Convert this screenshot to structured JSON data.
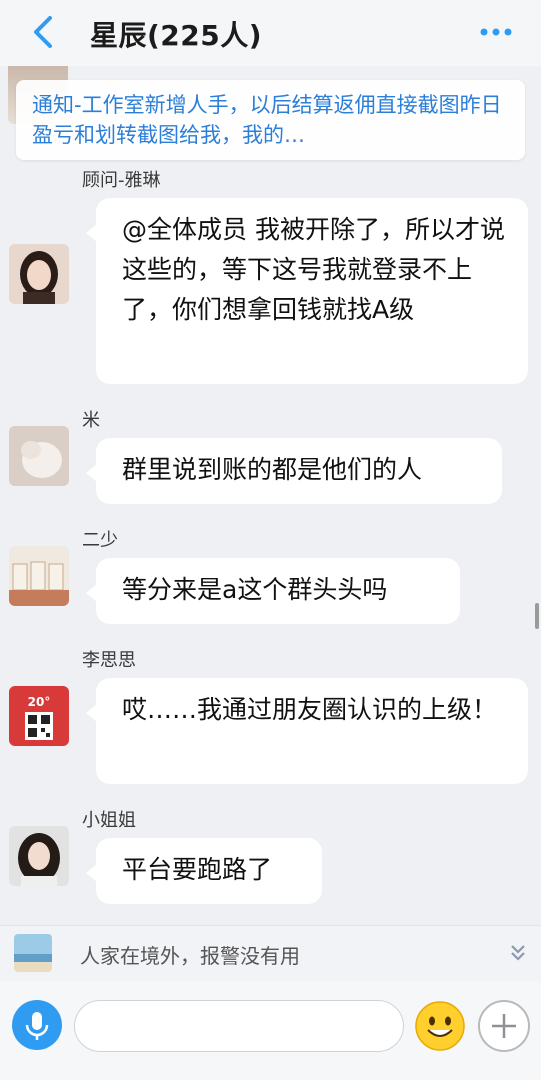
{
  "header": {
    "title": "星辰(225人)",
    "back_icon": "chevron-left-icon",
    "more_icon": "more-dots-icon",
    "accent_color": "#2f9cf2"
  },
  "notice": {
    "text": "通知-工作室新增人手，以后结算返佣直接截图昨日盈亏和划转截图给我，我的…",
    "color": "#2b7fd9"
  },
  "messages": [
    {
      "sender": "顾问-雅琳",
      "text": "@全体成员 我被开除了，所以才说这些的，等下这号我就登录不上了，你们想拿回钱就找A级"
    },
    {
      "sender": "米",
      "text": "群里说到账的都是他们的人"
    },
    {
      "sender": "二少",
      "text": "等分来是a这个群头头吗"
    },
    {
      "sender": "李思思",
      "text": "哎……我通过朋友圈认识的上级！",
      "avatar_badge": "20°"
    },
    {
      "sender": "小姐姐",
      "text": "平台要跑路了"
    }
  ],
  "preview": {
    "text": "人家在境外，报警没有用",
    "chevron_icon": "double-chevron-down-icon"
  },
  "input_bar": {
    "voice_icon": "microphone-icon",
    "placeholder": "",
    "emoji_icon": "smiley-face-icon",
    "add_icon": "plus-icon"
  }
}
